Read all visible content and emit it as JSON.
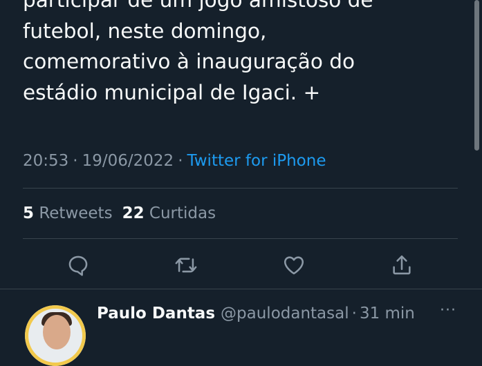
{
  "tweet": {
    "lines": [
      "participar de um jogo amistoso de",
      "futebol, neste domingo,",
      "comemorativo à inauguração do",
      "estádio municipal de Igaci. +"
    ],
    "time": "20:53",
    "date": "19/06/2022",
    "separator": "·",
    "source": "Twitter for iPhone"
  },
  "stats": {
    "retweets_count": "5",
    "retweets_label": "Retweets",
    "likes_count": "22",
    "likes_label": "Curtidas"
  },
  "actions": [
    {
      "icon": "reply-icon"
    },
    {
      "icon": "retweet-icon"
    },
    {
      "icon": "like-icon"
    },
    {
      "icon": "share-icon"
    }
  ],
  "reply": {
    "name": "Paulo Dantas",
    "handle": "@paulodantasal",
    "separator": "·",
    "time": "31 min",
    "more": "···"
  },
  "colors": {
    "background": "#15202b",
    "text": "#f7f9f9",
    "muted": "#8b98a5",
    "link": "#1d9bf0",
    "divider": "#38444d"
  }
}
